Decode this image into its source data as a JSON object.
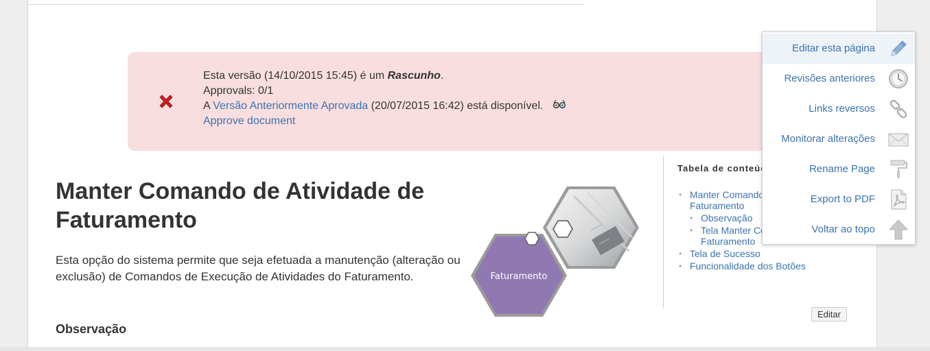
{
  "alert": {
    "line1_prefix": "Esta versão (14/10/2015 15:45) é um ",
    "line1_status": "Rascunho",
    "line1_suffix": ".",
    "approvals": "Approvals: 0/1",
    "line3_prefix": "A ",
    "line3_link": "Versão Anteriormente Aprovada",
    "line3_suffix": " (20/07/2015 16:42) está disponível.",
    "approve_link": "Approve document"
  },
  "page": {
    "title": "Manter Comando de Atividade de Faturamento",
    "description": "Esta opção do sistema permite que seja efetuada a manutenção (alteração ou exclusão) de Comandos de Execução de Atividades do Faturamento.",
    "section_heading": "Observação",
    "graphic_label": "Faturamento"
  },
  "toc": {
    "title": "Tabela de conteúdo",
    "items": [
      "Manter Comando de Atividade de Faturamento",
      "Observação",
      "Tela Manter Comando de Atividade de Faturamento",
      "Tela de Sucesso",
      "Funcionalidade dos Botões"
    ],
    "edit_label": "Editar"
  },
  "menu": {
    "items": [
      {
        "label": "Editar esta página",
        "icon": "pencil-icon"
      },
      {
        "label": "Revisões anteriores",
        "icon": "clock-icon"
      },
      {
        "label": "Links reversos",
        "icon": "chain-link-icon"
      },
      {
        "label": "Monitorar alterações",
        "icon": "envelope-icon"
      },
      {
        "label": "Rename Page",
        "icon": "paint-roller-icon"
      },
      {
        "label": "Export to PDF",
        "icon": "pdf-icon"
      },
      {
        "label": "Voltar ao topo",
        "icon": "arrow-up-icon"
      }
    ]
  },
  "colors": {
    "alert_bg": "#f9dedf",
    "link": "#3b73af",
    "hexagon_purple": "#9079b3",
    "error_x": "#cc1f1f"
  }
}
